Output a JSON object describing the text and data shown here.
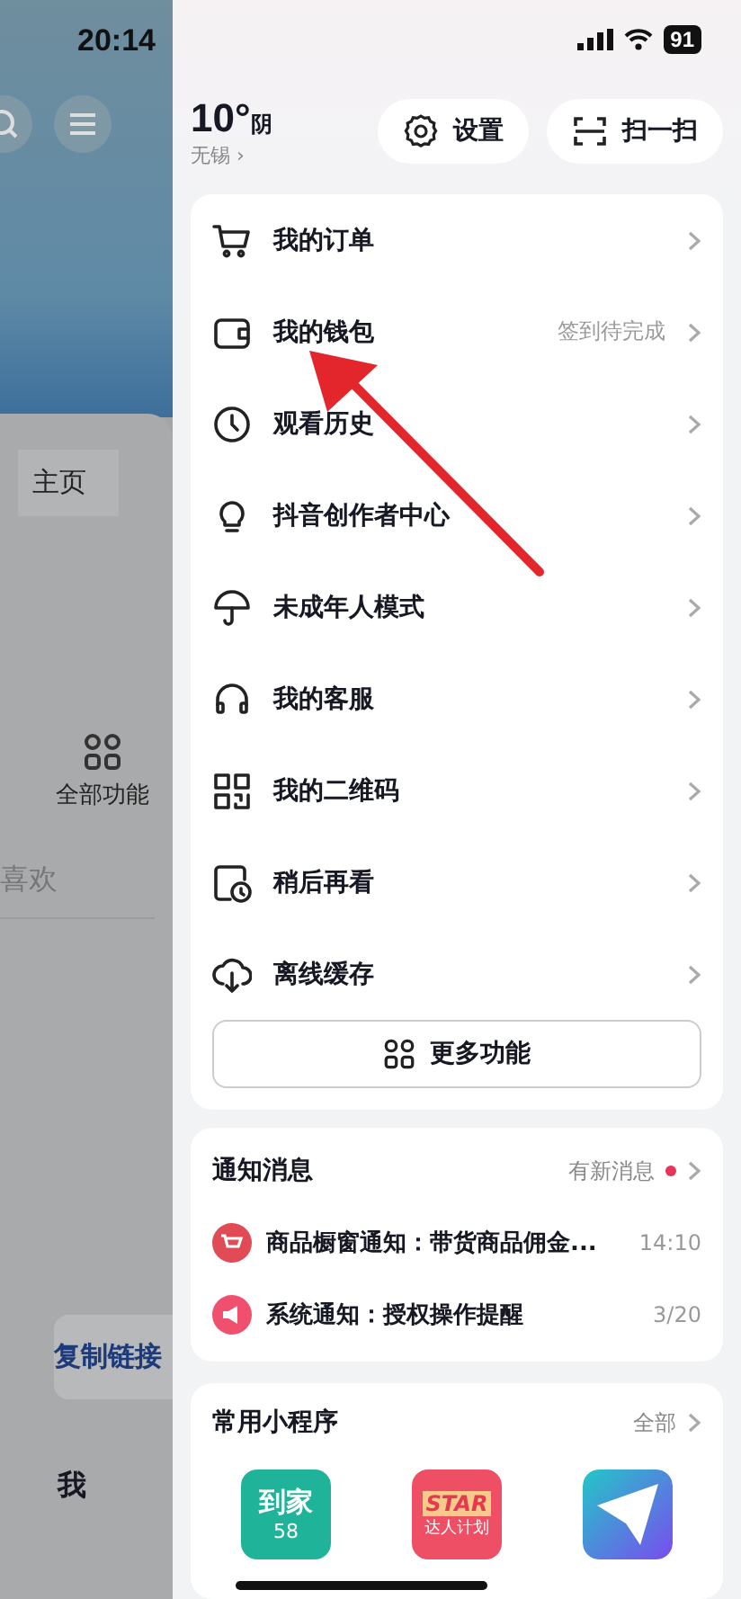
{
  "status_bar": {
    "time": "20:14",
    "battery": "91"
  },
  "background_page": {
    "items": [
      {
        "kind": "tab",
        "label": "主页"
      },
      {
        "kind": "grid",
        "label": "全部功能"
      },
      {
        "kind": "text",
        "label": "喜欢"
      },
      {
        "kind": "button",
        "label": "复制链接"
      },
      {
        "kind": "text",
        "label": "我"
      }
    ]
  },
  "weather": {
    "temperature": "10°",
    "condition": "阴",
    "city": "无锡 ›"
  },
  "header_buttons": [
    {
      "kind": "settings",
      "label": "设置"
    },
    {
      "kind": "scan",
      "label": "扫一扫"
    }
  ],
  "menu": [
    {
      "kind": "cart",
      "label": "我的订单"
    },
    {
      "kind": "wallet",
      "label": "我的钱包",
      "note": "签到待完成"
    },
    {
      "kind": "clock",
      "label": "观看历史"
    },
    {
      "kind": "bulb",
      "label": "抖音创作者中心"
    },
    {
      "kind": "umbrella",
      "label": "未成年人模式"
    },
    {
      "kind": "headset",
      "label": "我的客服"
    },
    {
      "kind": "qrcode",
      "label": "我的二维码"
    },
    {
      "kind": "later",
      "label": "稍后再看"
    },
    {
      "kind": "download",
      "label": "离线缓存"
    }
  ],
  "more_button": "更多功能",
  "notifications": {
    "title": "通知消息",
    "status": "有新消息",
    "unread": true,
    "items": [
      {
        "kind": "cart",
        "text": "商品橱窗通知：带货商品佣金...",
        "time": "14:10"
      },
      {
        "kind": "horn",
        "text": "系统通知：授权操作提醒",
        "time": "3/20"
      }
    ]
  },
  "mini_programs": {
    "title": "常用小程序",
    "link": "全部",
    "apps": [
      {
        "kind": "home",
        "line1": "到家",
        "line2": "58"
      },
      {
        "kind": "star",
        "line1": "STAR",
        "line2": "达人计划"
      },
      {
        "kind": "plane"
      }
    ]
  }
}
